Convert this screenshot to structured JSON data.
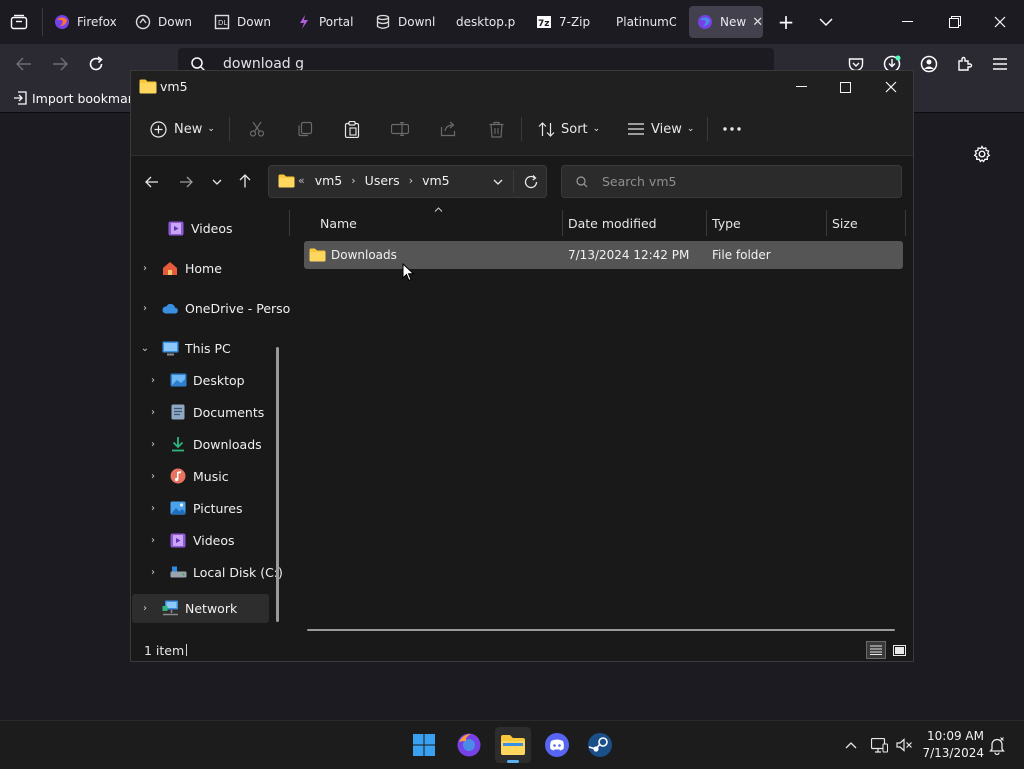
{
  "browser": {
    "tabs": [
      {
        "label": "Firefox",
        "icon": "firefox-icon"
      },
      {
        "label": "Downl",
        "icon": "download-site-icon"
      },
      {
        "label": "Downl",
        "icon": "download-site-icon"
      },
      {
        "label": "Portal",
        "icon": "portal-icon"
      },
      {
        "label": "Downl",
        "icon": "database-icon"
      },
      {
        "label": "desktop.pr",
        "icon": ""
      },
      {
        "label": "7-Zip",
        "icon": "7zip-icon"
      },
      {
        "label": "PlatinumO",
        "icon": ""
      },
      {
        "label": "New",
        "icon": "firefox-icon"
      }
    ],
    "url_text": "download g",
    "bookmark_label": "Import bookmarks"
  },
  "explorer": {
    "title": "vm5",
    "toolbar": {
      "new_label": "New",
      "sort_label": "Sort",
      "view_label": "View"
    },
    "breadcrumb": {
      "overflow": "«",
      "items": [
        "vm5",
        "Users",
        "vm5"
      ]
    },
    "search_placeholder": "Search vm5",
    "nav": {
      "videos_top": "Videos",
      "home": "Home",
      "onedrive": "OneDrive - Perso",
      "this_pc": "This PC",
      "desktop": "Desktop",
      "documents": "Documents",
      "downloads": "Downloads",
      "music": "Music",
      "pictures": "Pictures",
      "videos": "Videos",
      "local_disk": "Local Disk (C:)",
      "network": "Network"
    },
    "columns": {
      "name": "Name",
      "date": "Date modified",
      "type": "Type",
      "size": "Size"
    },
    "rows": [
      {
        "name": "Downloads",
        "date": "7/13/2024 12:42 PM",
        "type": "File folder",
        "size": ""
      }
    ],
    "status": "1 item"
  },
  "taskbar": {
    "time": "10:09 AM",
    "date": "7/13/2024"
  },
  "colors": {
    "accent": "#0078d4",
    "selection": "#555555",
    "folder": "#f8c73a"
  }
}
